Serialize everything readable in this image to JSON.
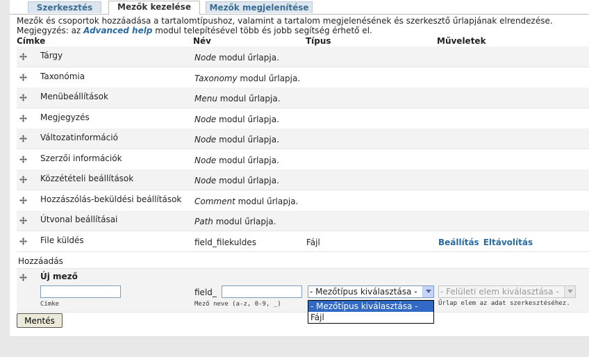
{
  "tabs": [
    {
      "label": "Szerkesztés",
      "active": false
    },
    {
      "label": "Mezők kezelése",
      "active": true
    },
    {
      "label": "Mezők megjelenítése",
      "active": false
    }
  ],
  "help": {
    "line1": "Mezők és csoportok hozzáadása a tartalomtípushoz, valamint a tartalom megjelenésének és szerkesztő űrlapjának elrendezése.",
    "line2_pre": "Megjegyzés: az ",
    "line2_link": "Advanced help",
    "line2_post": " modul telepítésével több és jobb segítség érhető el."
  },
  "table": {
    "headers": {
      "label": "Címke",
      "name": "Név",
      "type": "Típus",
      "ops": "Műveletek"
    },
    "rows": [
      {
        "label": "Tárgy",
        "module": "Node",
        "suffix": " modul űrlapja."
      },
      {
        "label": "Taxonómia",
        "module": "Taxonomy",
        "suffix": " modul űrlapja."
      },
      {
        "label": "Menübeállítások",
        "module": "Menu",
        "suffix": " modul űrlapja."
      },
      {
        "label": "Megjegyzés",
        "module": "Node",
        "suffix": " modul űrlapja."
      },
      {
        "label": "Változatinformáció",
        "module": "Node",
        "suffix": " modul űrlapja."
      },
      {
        "label": "Szerzői információk",
        "module": "Node",
        "suffix": " modul űrlapja."
      },
      {
        "label": "Közzétételi beállítások",
        "module": "Node",
        "suffix": " modul űrlapja."
      },
      {
        "label": "Hozzászólás-beküldési beállítások",
        "module": "Comment",
        "suffix": " modul űrlapja."
      },
      {
        "label": "Útvonal beállításai",
        "module": "Path",
        "suffix": " modul űrlapja."
      }
    ],
    "field_row": {
      "label": "File küldés",
      "name": "field_filekuldes",
      "type": "Fájl",
      "op_configure": "Beállítás",
      "op_remove": "Eltávolítás"
    }
  },
  "add": {
    "section_title": "Hozzáadás",
    "new_field_title": "Új mező",
    "label_value": "",
    "label_caption": "Címke",
    "name_prefix": "field_",
    "name_value": "",
    "name_caption": "Mező neve (a-z, 0-9, _)",
    "type_select": "- Mezőtípus kiválasztása -",
    "widget_select": "- Felületi elem kiválasztása -",
    "widget_caption": "Űrlap elem az adat szerkesztéséhez.",
    "dropdown_options": [
      "- Mezőtípus kiválasztása -",
      "Fájl"
    ]
  },
  "save_label": "Mentés",
  "colors": {
    "link": "#2a6aa3",
    "selected_option": "#316ac5"
  }
}
